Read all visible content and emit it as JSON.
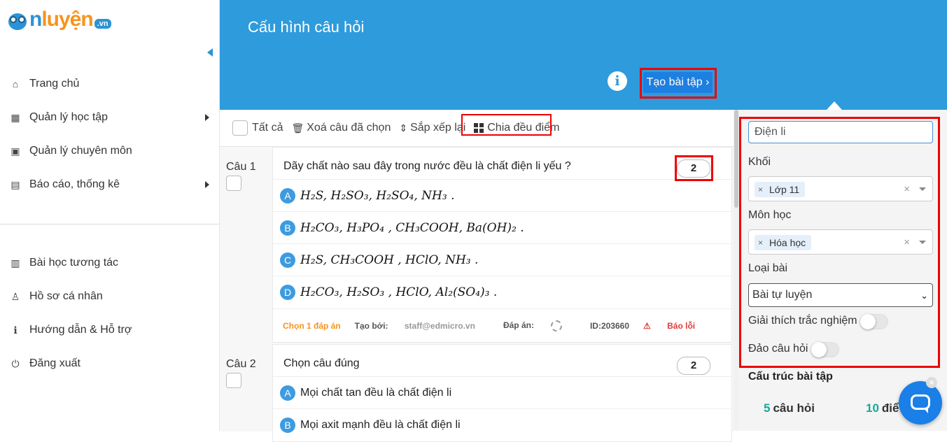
{
  "logo": {
    "brand_o": "o",
    "brand_n": "n",
    "brand_luyen": "luyện",
    "tld": ".vn"
  },
  "sidebar": {
    "top_items": [
      {
        "label": "Trang chủ",
        "icon": "home-icon"
      },
      {
        "label": "Quản lý học tập",
        "icon": "school-icon",
        "has_submenu": true
      },
      {
        "label": "Quản lý chuyên môn",
        "icon": "calendar-icon"
      },
      {
        "label": "Báo cáo, thống kê",
        "icon": "report-icon",
        "has_submenu": true
      }
    ],
    "bottom_items": [
      {
        "label": "Bài học tương tác",
        "icon": "interactive-lesson-icon"
      },
      {
        "label": "Hồ sơ cá nhân",
        "icon": "user-icon"
      },
      {
        "label": "Hướng dẫn & Hỗ trợ",
        "icon": "help-icon"
      },
      {
        "label": "Đăng xuất",
        "icon": "power-icon"
      }
    ]
  },
  "header": {
    "title": "Cấu hình câu hỏi",
    "info_icon": "i",
    "create_button": "Tạo bài tập ›"
  },
  "toolbar": {
    "select_all": "Tất cả",
    "delete_selected": "Xoá câu đã chọn",
    "reorder": "Sắp xếp lại",
    "split_points": "Chia đều điểm"
  },
  "questions": [
    {
      "number": "Câu 1",
      "text": "Dãy chất nào sau đây trong nước đều là chất điện li yếu ?",
      "score": "2",
      "options": [
        {
          "letter": "A",
          "content": "H₂S, H₂SO₃, H₂SO₄, NH₃ ."
        },
        {
          "letter": "B",
          "content": "H₂CO₃, H₃PO₄ , CH₃COOH, Ba(OH)₂ ."
        },
        {
          "letter": "C",
          "content": "H₂S, CH₃COOH , HClO, NH₃ ."
        },
        {
          "letter": "D",
          "content": "H₂CO₃, H₂SO₃ , HClO, Al₂(SO₄)₃ ."
        }
      ],
      "meta": {
        "answer_count": "Chọn 1 đáp án",
        "created_by_label": "Tạo bởi:",
        "created_by": "staff@edmicro.vn",
        "answer_label": "Đáp án:",
        "id": "ID:203660",
        "report": "Báo lỗi"
      }
    },
    {
      "number": "Câu 2",
      "text": "Chọn câu đúng",
      "score": "2",
      "options": [
        {
          "letter": "A",
          "content": "Mọi chất tan đều là chất điện li"
        },
        {
          "letter": "B",
          "content": "Mọi axit mạnh đều là chất điện li"
        }
      ]
    }
  ],
  "filters": {
    "search_value": "Điện li",
    "grade_label": "Khối",
    "grade_tag": "Lớp 11",
    "subject_label": "Môn học",
    "subject_tag": "Hóa học",
    "type_label": "Loại bài",
    "type_value": "Bài tự luyện",
    "explain_label": "Giải thích trắc nghiệm",
    "explain_on": false,
    "shuffle_label": "Đảo câu hỏi",
    "shuffle_on": false,
    "clear_symbol": "×",
    "tag_remove_symbol": "×"
  },
  "structure": {
    "title": "Cấu trúc bài tập",
    "question_count": "5",
    "question_unit": "câu hỏi",
    "point_count": "10",
    "point_unit": "điể"
  },
  "colors": {
    "header_bg": "#2e9bdc",
    "primary_button": "#1d7fe0",
    "highlight_outline": "#e00000",
    "option_badge": "#3d9be0",
    "stat_number": "#1aa896"
  }
}
